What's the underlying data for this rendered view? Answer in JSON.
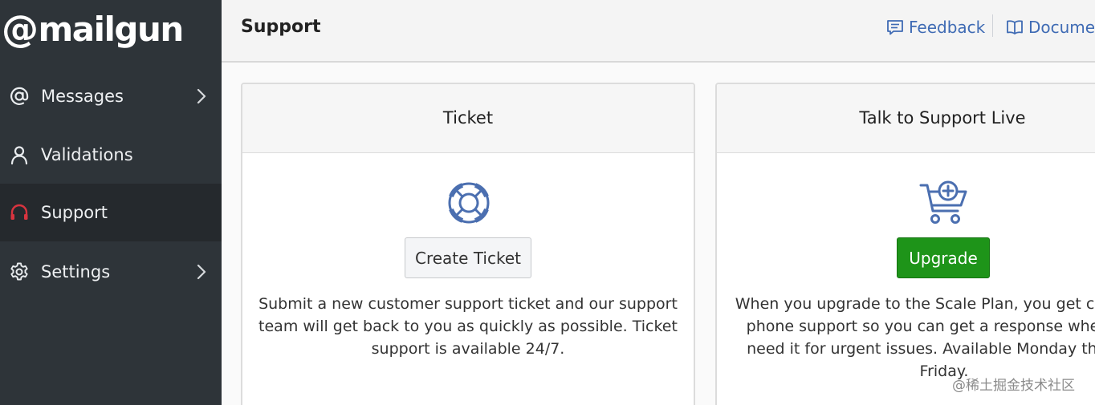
{
  "brand": {
    "logo_at": "@",
    "logo_text": "mailgun"
  },
  "sidebar": {
    "items": [
      {
        "label": "Messages",
        "icon": "at-icon",
        "has_chevron": true,
        "active": false
      },
      {
        "label": "Validations",
        "icon": "user-icon",
        "has_chevron": false,
        "active": false
      },
      {
        "label": "Support",
        "icon": "headset-icon",
        "has_chevron": false,
        "active": true
      },
      {
        "label": "Settings",
        "icon": "gear-icon",
        "has_chevron": true,
        "active": false
      }
    ]
  },
  "header": {
    "title": "Support",
    "links": [
      {
        "label": "Feedback",
        "icon": "feedback-icon"
      },
      {
        "label": "Documentation",
        "icon": "book-icon"
      }
    ]
  },
  "cards": [
    {
      "title": "Ticket",
      "icon": "lifebuoy-icon",
      "button_label": "Create Ticket",
      "text_lines": [
        "Submit a new customer support ticket and our support",
        "team will get back to you as quickly as possible. Ticket",
        "support is available 24/7."
      ]
    },
    {
      "title": "Talk to Support Live",
      "icon": "cart-plus-icon",
      "button_label": "Upgrade",
      "text_lines": [
        "When you upgrade to the Scale Plan, you get chat and",
        "phone support so you can get a response when you",
        "need it for urgent issues. Available Monday through",
        "Friday."
      ]
    }
  ],
  "watermark": "@稀土掘金技术社区",
  "colors": {
    "sidebar_bg": "#2e3439",
    "active_item_bg": "#25292d",
    "support_icon": "#d8343f",
    "link_blue": "#3f6bb4",
    "success_green": "#1e9419"
  }
}
